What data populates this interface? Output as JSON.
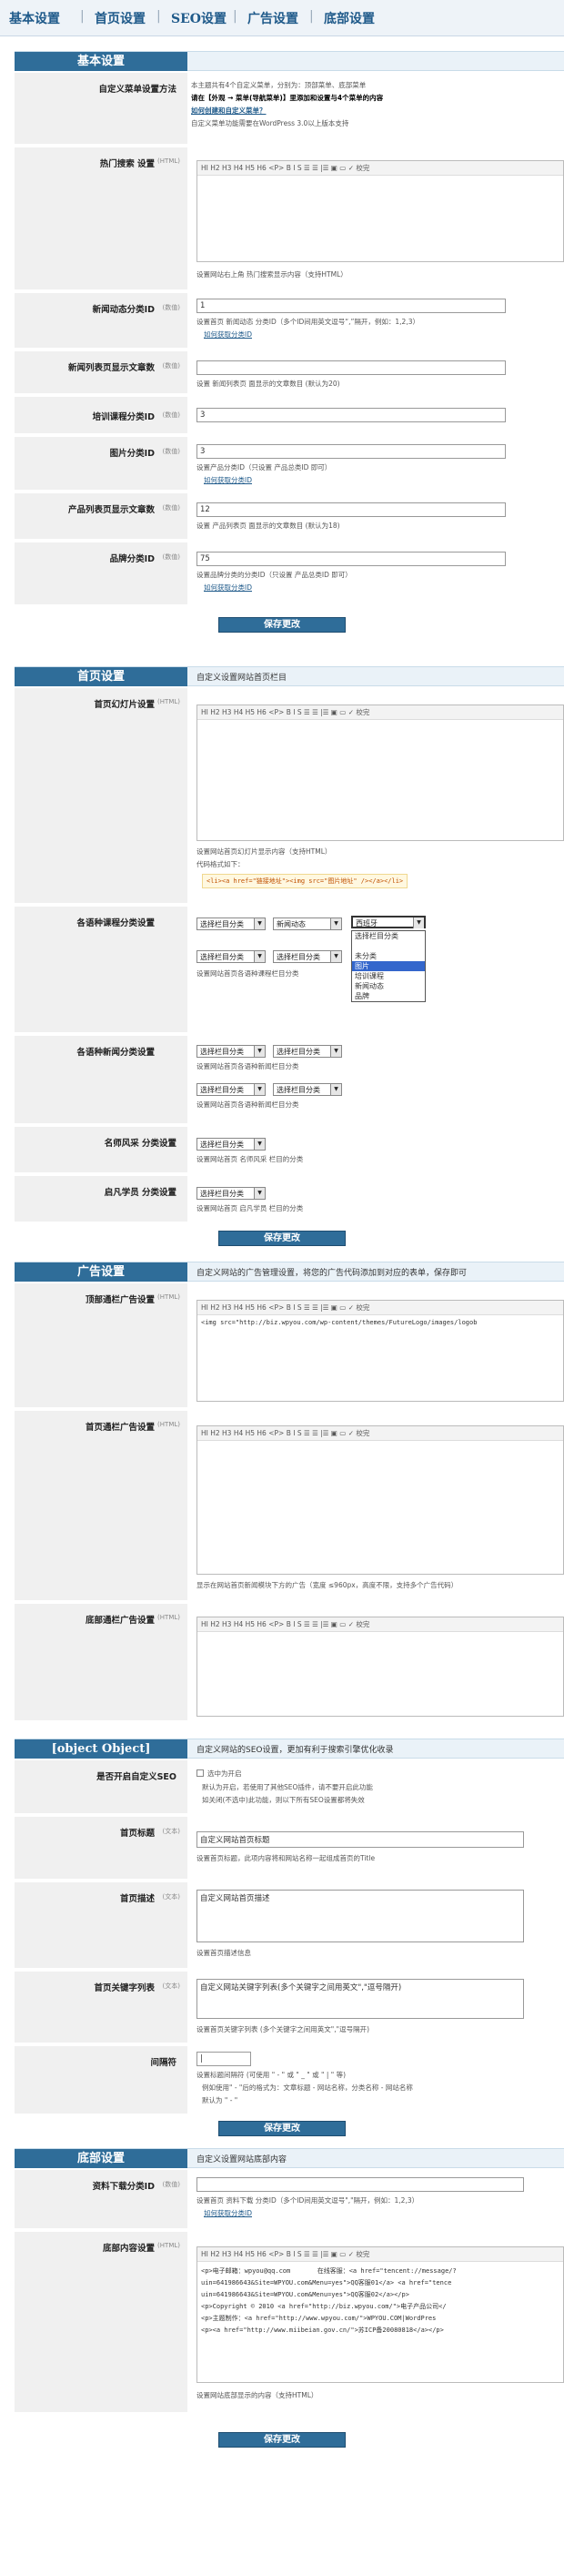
{
  "nav": [
    "基本设置",
    "首页设置",
    "SEO设置",
    "广告设置",
    "底部设置"
  ],
  "btn_save": "保存更改",
  "editor_toolbar": "HI H2 H3 H4 H5 H6 <P>  B  I  S    ☰ ☰ |☰   ▣  ▭   ✓ 校完",
  "s1": {
    "title": "基本设置",
    "menu": {
      "label": "自定义菜单设置方法",
      "lines": [
        "本主题共有4个自定义菜单，分别为：顶部菜单、底部菜单",
        "请在【外观 → 菜单(导航菜单)】里添加和设置与4个菜单的内容",
        "如何创建和自定义菜单？",
        "自定义菜单功能需要在WordPress 3.0以上版本支持"
      ]
    },
    "hot": {
      "label": "热门搜索 设置",
      "key": "(HTML)",
      "help": "设置网站右上角 热门搜索显示内容（支持HTML）"
    },
    "newsid": {
      "label": "新闻动态分类ID",
      "key": "(数值)",
      "value": "1",
      "help": "设置首页 新闻动态 分类ID（多个ID间用英文逗号“,”隔开，例如：1,2,3）",
      "link": "如何获取分类ID"
    },
    "newscount": {
      "label": "新闻列表页显示文章数",
      "key": "(数值)",
      "value": "",
      "help": "设置 新闻列表页 面显示的文章数目 (默认为20)"
    },
    "case": {
      "label": "培训课程分类ID",
      "key": "(数值)",
      "value": "3"
    },
    "pic": {
      "label": "图片分类ID",
      "key": "(数值)",
      "value": "3",
      "help": "设置产品分类ID（只设置 产品总类ID 即可）",
      "link": "如何获取分类ID"
    },
    "prodcount": {
      "label": "产品列表页显示文章数",
      "key": "(数值)",
      "value": "12",
      "help": "设置 产品列表页 面显示的文章数目 (默认为18)"
    },
    "brand": {
      "label": "品牌分类ID",
      "key": "(数值)",
      "value": "75",
      "help": "设置品牌分类的分类ID（只设置 产品总类ID 即可）",
      "link": "如何获取分类ID"
    }
  },
  "s2": {
    "title": "首页设置",
    "desc": "自定义设置网站首页栏目",
    "slide": {
      "label": "首页幻灯片设置",
      "key": "(HTML)",
      "help": "设置网站首页幻灯片显示内容（支持HTML）",
      "help2": "代码格式如下：",
      "code": "<li><a href=\"链接地址\"><img src=\"图片地址\" /></a></li>"
    },
    "block1": {
      "label": "各语种课程分类设置",
      "sels": [
        "选择栏目分类",
        "新闻动态",
        "西班牙",
        "选择栏目分类",
        "选择栏目分类"
      ],
      "help": "设置网站首页各语种课程栏目分类",
      "dd": [
        "选择栏目分类",
        "",
        "未分类",
        "图片",
        "培训课程",
        "新闻动态",
        "品牌"
      ]
    },
    "block2": {
      "label": "各语种新闻分类设置",
      "sels": [
        "选择栏目分类",
        "选择栏目分类",
        "选择栏目分类",
        "选择栏目分类"
      ],
      "help": "设置网站首页各语种新闻栏目分类"
    },
    "block3": {
      "label": "名师风采 分类设置",
      "sel": "选择栏目分类",
      "help": "设置网站首页 名师风采 栏目的分类"
    },
    "block4": {
      "label": "启凡学员 分类设置",
      "sel": "选择栏目分类",
      "help": "设置网站首页 启凡学员 栏目的分类"
    }
  },
  "s3": {
    "title": "广告设置",
    "desc": "自定义网站的广告管理设置，将您的广告代码添加到对应的表单，保存即可",
    "top": {
      "label": "顶部通栏广告设置",
      "key": "(HTML)",
      "code": "<img src=\"http://biz.wpyou.com/wp-content/themes/FutureLogo/images/logob"
    },
    "home": {
      "label": "首页通栏广告设置",
      "key": "(HTML)",
      "help": "显示在网站首页新闻模块下方的广告（宽度 ≤960px，高度不限，支持多个广告代码）"
    },
    "bottom": {
      "label": "底部通栏广告设置",
      "key": "(HTML)"
    }
  },
  "s4": {
    "title": {
      "label": "首页标题",
      "key": "(文本)",
      "value": "自定义网站首页标题",
      "help": "设置首页标题，此项内容将和网站名称一起组成首页的Title"
    },
    "desc": "自定义网站的SEO设置，更加有利于搜索引擎优化收录",
    "enable": {
      "label": "是否开启自定义SEO",
      "opt": "选中为开启",
      "l1": "默认为开启，若使用了其他SEO插件，请不要开启此功能",
      "l2": "如关闭(不选中)此功能，则以下所有SEO设置都将失效"
    },
    "descr": {
      "label": "首页描述",
      "key": "(文本)",
      "value": "自定义网站首页描述",
      "help": "设置首页描述信息"
    },
    "kw": {
      "label": "首页关键字列表",
      "key": "(文本)",
      "value": "自定义网站关键字列表(多个关键字之间用英文\",\"逗号隔开)",
      "help": "设置首页关键字列表 (多个关键字之间用英文\",\"逗号隔开)"
    },
    "sepr": {
      "label": "间隔符",
      "value": "|",
      "help": "设置标题间隔符 (可使用 \" - \" 或 \" _ \" 或 \" | \" 等)",
      "l2": "例如使用\" - \"后的格式为：文章标题 - 网站名称，分类名称 - 网站名称",
      "l3": "默认为 \" - \""
    }
  },
  "s5": {
    "title": "底部设置",
    "desc": "自定义设置网站底部内容",
    "dl": {
      "label": "资料下载分类ID",
      "key": "(数值)",
      "value": "",
      "help": "设置首页 资料下载 分类ID（多个ID间用英文逗号\",\"隔开，例如：1,2,3）",
      "link": "如何获取分类ID"
    },
    "foot": {
      "label": "底部内容设置",
      "key": "(HTML)",
      "lines": [
        "<p>电子邮箱：wpyou@qq.com       在线客服：<a href=\"tencent://message/?",
        "uin=641986643&Site=WPYOU.com&Menu=yes\">QQ客服01</a> <a href=\"tence",
        "uin=641986643&Site=WPYOU.com&Menu=yes\">QQ客服02</a></p>",
        "<p>Copyright © 2010 <a href=\"http://biz.wpyou.com/\">电子产品公司</",
        "<p>主题制作：<a href=\"http://www.wpyou.com/\">WPYOU.COM|WordPres",
        "<p><a href=\"http://www.miibeian.gov.cn/\">苏ICP备20080818</a></p>"
      ],
      "help": "设置网站底部显示的内容（支持HTML）"
    }
  }
}
